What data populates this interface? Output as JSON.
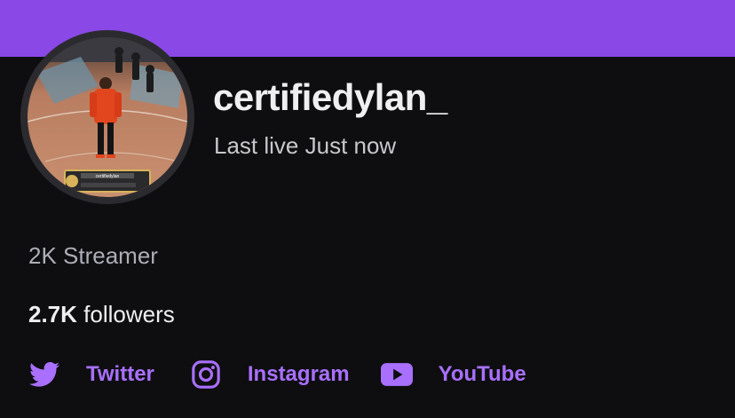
{
  "profile": {
    "username": "certifiedylan_",
    "status": "Last live Just now",
    "bio": "2K Streamer",
    "followers_count": "2.7K",
    "followers_label": "followers",
    "avatar_caption": "certifiedylan"
  },
  "socials": [
    {
      "label": "Twitter",
      "icon": "twitter-icon"
    },
    {
      "label": "Instagram",
      "icon": "instagram-icon"
    },
    {
      "label": "YouTube",
      "icon": "youtube-icon"
    }
  ],
  "colors": {
    "banner": "#8a48e6",
    "background": "#0e0e10",
    "link": "#a970ff"
  }
}
